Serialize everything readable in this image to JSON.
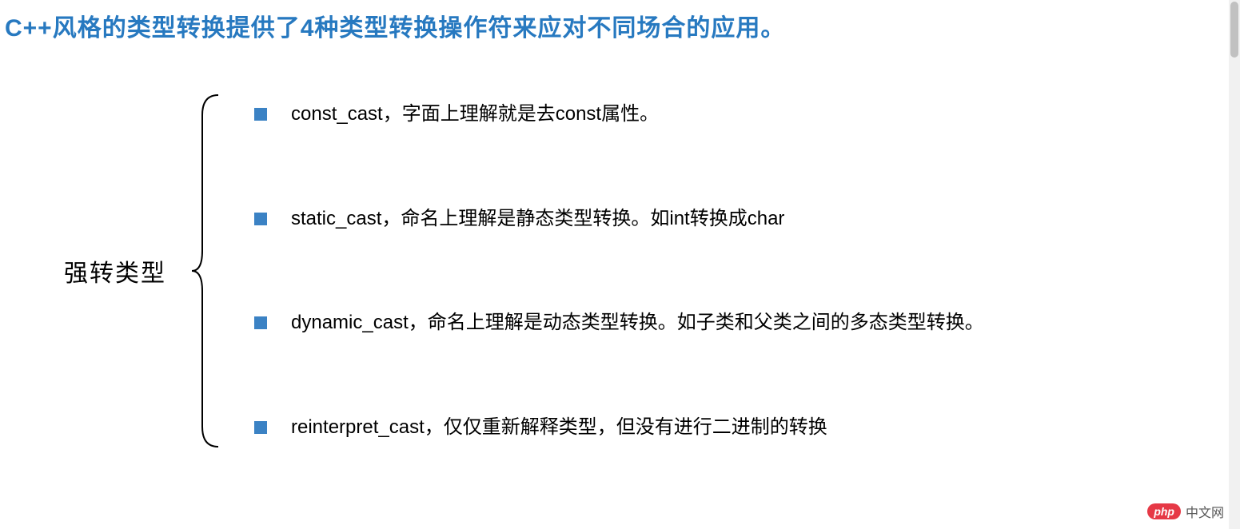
{
  "title": "C++风格的类型转换提供了4种类型转换操作符来应对不同场合的应用。",
  "category": "强转类型",
  "items": [
    "const_cast，字面上理解就是去const属性。",
    "static_cast，命名上理解是静态类型转换。如int转换成char",
    "dynamic_cast，命名上理解是动态类型转换。如子类和父类之间的多态类型转换。",
    "reinterpret_cast，仅仅重新解释类型，但没有进行二进制的转换"
  ],
  "watermark": {
    "logo": "php",
    "text": "中文网"
  }
}
